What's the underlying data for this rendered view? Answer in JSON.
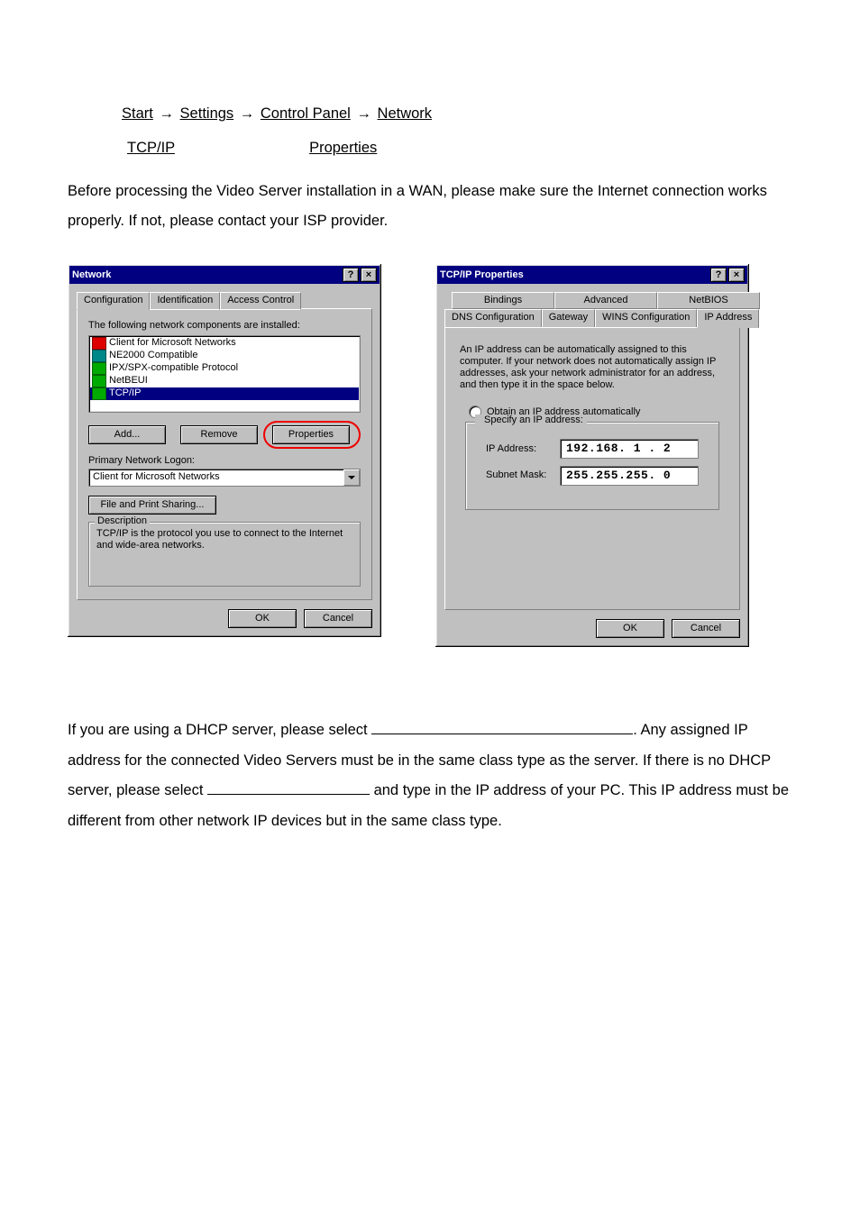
{
  "path": {
    "p1": "Start",
    "p2": "Settings",
    "p3": "Control Panel",
    "p4": "Network",
    "row2a": "TCP/IP",
    "row2b": "Properties"
  },
  "intro": "Before processing the Video Server installation in a WAN, please make sure the Internet connection works properly. If not, please contact your ISP provider.",
  "network_dlg": {
    "title": "Network",
    "tabs": {
      "t1": "Configuration",
      "t2": "Identification",
      "t3": "Access Control"
    },
    "list_label": "The following network components are installed:",
    "items": {
      "i1": "Client for Microsoft Networks",
      "i2": "NE2000 Compatible",
      "i3": "IPX/SPX-compatible Protocol",
      "i4": "NetBEUI",
      "i5": "TCP/IP"
    },
    "buttons": {
      "add": "Add...",
      "remove": "Remove",
      "props": "Properties"
    },
    "primary_label": "Primary Network Logon:",
    "primary_value": "Client for Microsoft Networks",
    "file_print": "File and Print Sharing...",
    "desc_title": "Description",
    "desc_text": "TCP/IP is the protocol you use to connect to the Internet and wide-area networks.",
    "ok": "OK",
    "cancel": "Cancel",
    "help_glyph": "?",
    "close_glyph": "×"
  },
  "tcpip_dlg": {
    "title": "TCP/IP Properties",
    "tabs_row1": {
      "t1": "Bindings",
      "t2": "Advanced",
      "t3": "NetBIOS"
    },
    "tabs_row2": {
      "t1": "DNS Configuration",
      "t2": "Gateway",
      "t3": "WINS Configuration",
      "t4": "IP Address"
    },
    "info": "An IP address can be automatically assigned to this computer. If your network does not automatically assign IP addresses, ask your network administrator for an address, and then type it in the space below.",
    "opt_obtain": "Obtain an IP address automatically",
    "opt_specify": "Specify an IP address:",
    "ip_label": "IP Address:",
    "ip_value": "192.168.  1 .  2",
    "mask_label": "Subnet Mask:",
    "mask_value": "255.255.255.  0",
    "ok": "OK",
    "cancel": "Cancel",
    "help_glyph": "?",
    "close_glyph": "×"
  },
  "below": {
    "p1a": "If you are using a DHCP server, please select ",
    "p1b": ". Any assigned IP address for the connected Video Servers must be in the same class type as the server. If there is no DHCP server, please select ",
    "p1c": " and type in the IP address of your PC. This IP address must be different from other network IP devices but in the same class type."
  }
}
